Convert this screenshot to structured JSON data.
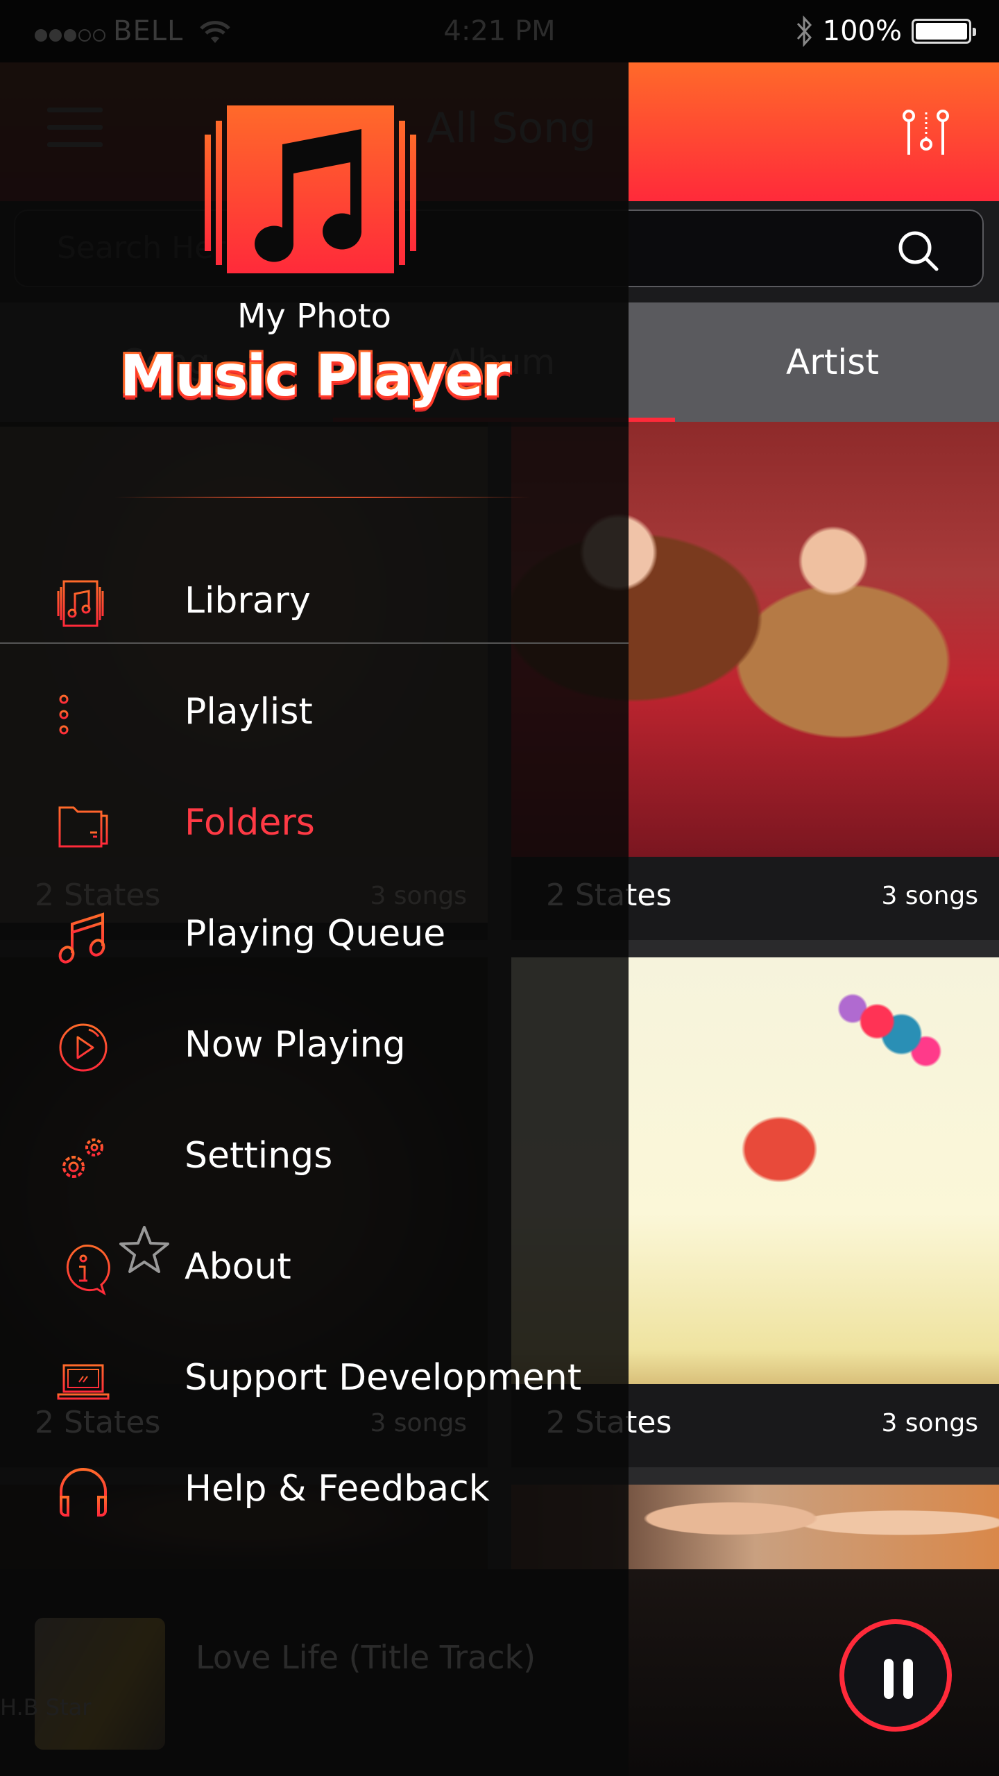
{
  "status_bar": {
    "carrier": "BELL",
    "signal_bars_filled": 3,
    "signal_bars_total": 5,
    "time": "4:21 PM",
    "battery": "100%",
    "icons": [
      "signal-dots-icon",
      "wifi-icon",
      "bluetooth-icon",
      "battery-icon"
    ]
  },
  "header": {
    "title": "All Song",
    "menu_icon": "hamburger-icon",
    "filter_icon": "equalizer-icon",
    "colors": {
      "gradient_top": "#ff6a2a",
      "gradient_bottom": "#ff2a3a"
    }
  },
  "search": {
    "placeholder": "Search Here",
    "icon": "search-icon"
  },
  "tabs": [
    {
      "label": "Song",
      "active": false
    },
    {
      "label": "Album",
      "active": true
    },
    {
      "label": "Artist",
      "active": false
    }
  ],
  "grid": [
    {
      "name": "2 States",
      "count": "3 songs"
    },
    {
      "name": "2 States",
      "count": "3 songs"
    },
    {
      "name": "2 States",
      "count": "3 songs"
    },
    {
      "name": "2 States",
      "count": "3 songs"
    }
  ],
  "player": {
    "title": "Love Life (Title Track)",
    "artist": "H.B Star",
    "state": "playing",
    "control_icon": "pause-icon",
    "accent": "#ff2a3a"
  },
  "drawer": {
    "subtitle": "My Photo",
    "title": "Music Player",
    "logo_icon": "music-note-logo-icon",
    "items": [
      {
        "label": "Library",
        "icon": "library-icon",
        "active": false
      },
      {
        "label": "Playlist",
        "icon": "playlist-icon",
        "active": false
      },
      {
        "label": "Folders",
        "icon": "folder-icon",
        "active": true
      },
      {
        "label": "Playing Queue",
        "icon": "music-note-icon",
        "active": false
      },
      {
        "label": "Now Playing",
        "icon": "play-circle-icon",
        "active": false
      },
      {
        "label": "Settings",
        "icon": "gears-icon",
        "active": false
      },
      {
        "label": "About",
        "icon": "info-icon",
        "active": false
      },
      {
        "label": "Support Development",
        "icon": "laptop-icon",
        "active": false
      },
      {
        "label": "Help & Feedback",
        "icon": "headphones-icon",
        "active": false
      }
    ],
    "accent": "#ff3a45"
  }
}
